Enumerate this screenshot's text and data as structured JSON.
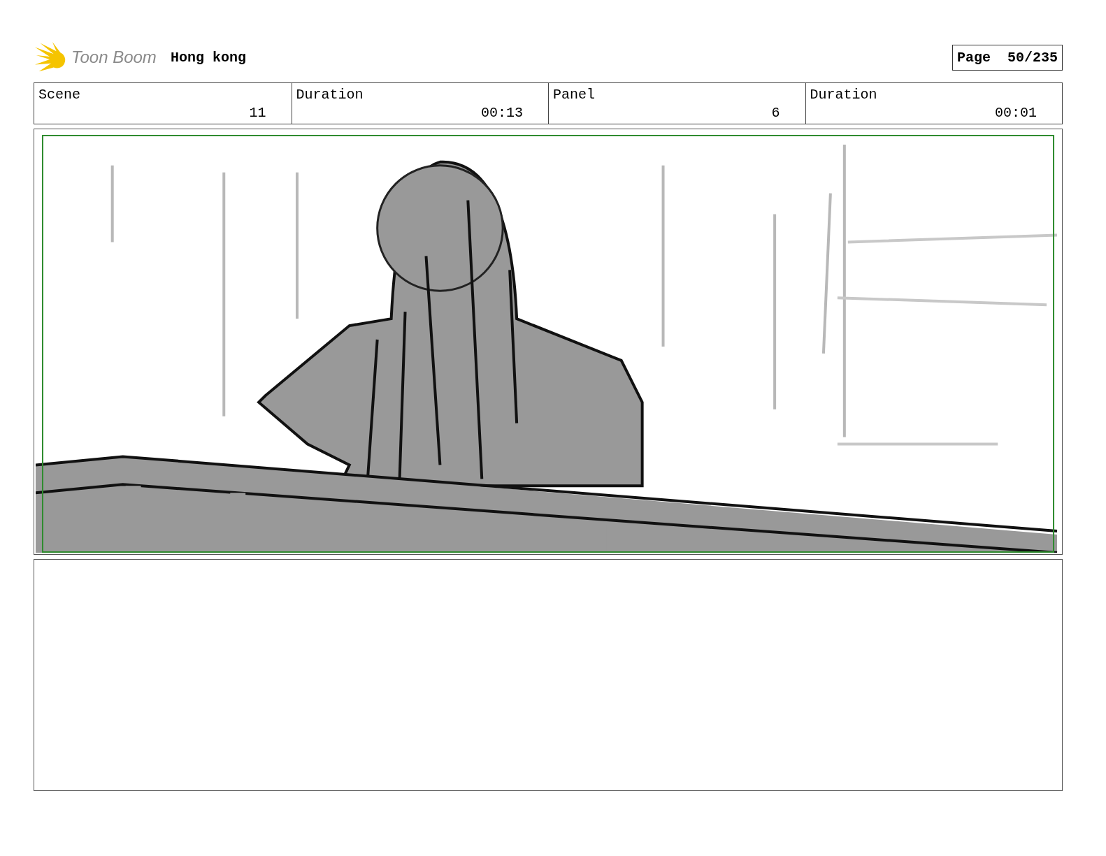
{
  "header": {
    "logo": "Toon Boom",
    "project": "Hong kong",
    "page_label": "Page",
    "page": "50/235"
  },
  "fields": [
    {
      "label": "Scene",
      "value": "11"
    },
    {
      "label": "Duration",
      "value": "00:13"
    },
    {
      "label": "Panel",
      "value": "6"
    },
    {
      "label": "Duration",
      "value": "00:01"
    }
  ]
}
